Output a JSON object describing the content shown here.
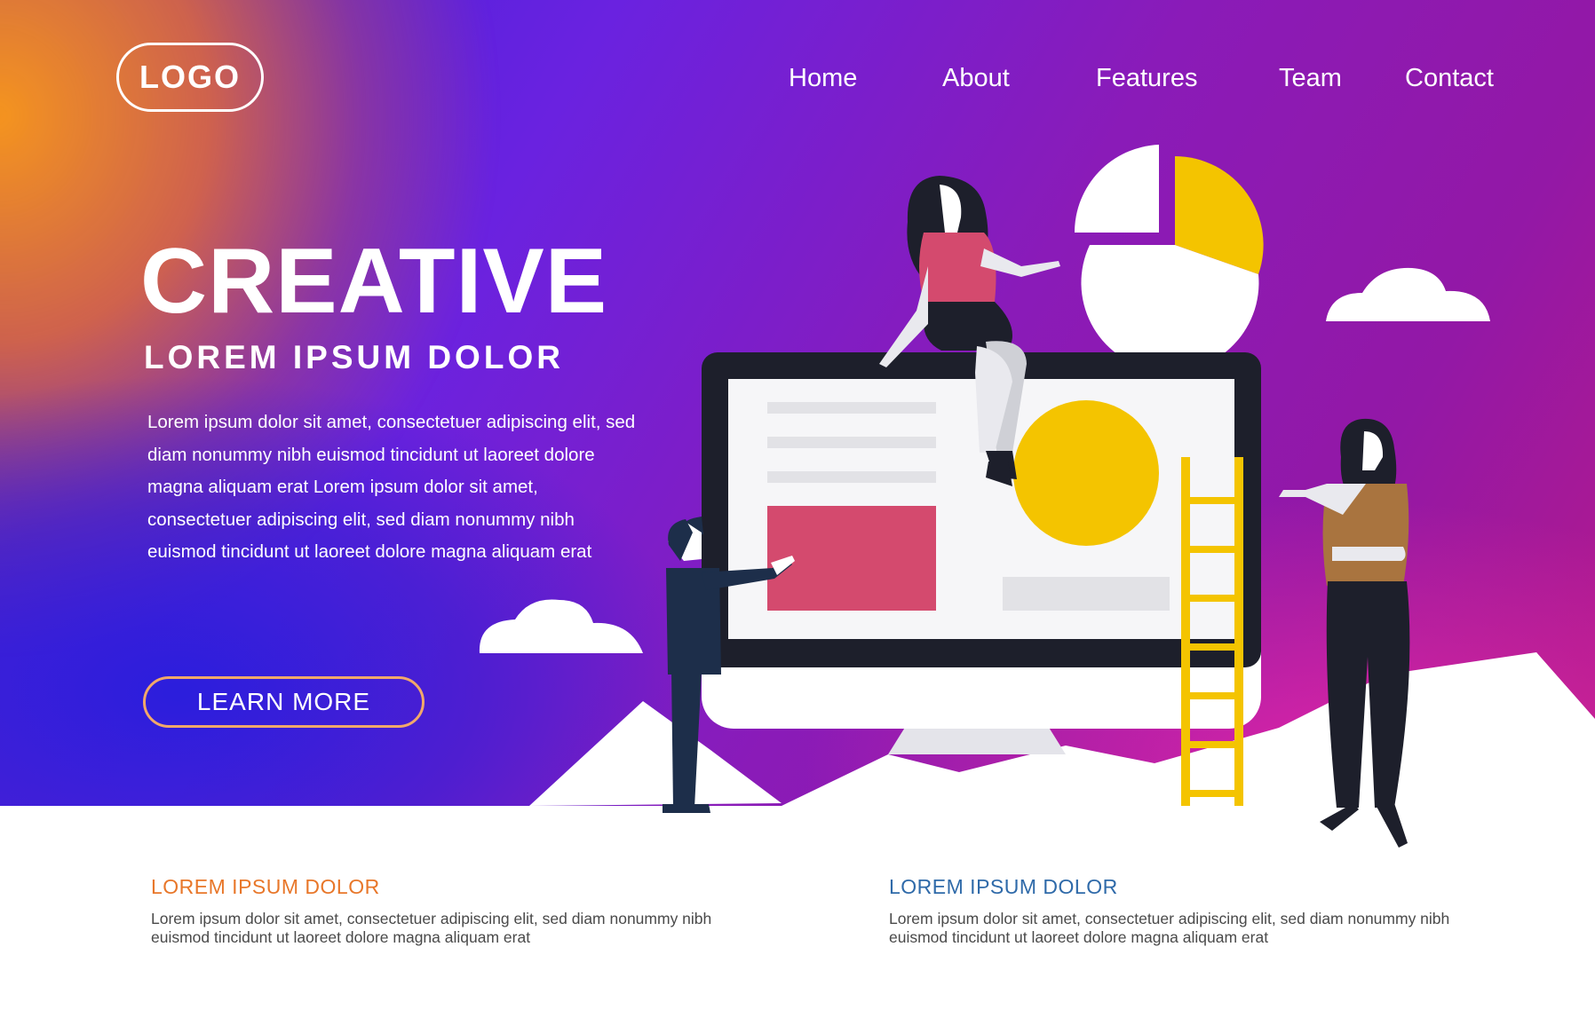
{
  "logo": {
    "text": "LOGO"
  },
  "nav": {
    "items": [
      {
        "label": "Home"
      },
      {
        "label": "About"
      },
      {
        "label": "Features"
      },
      {
        "label": "Team"
      },
      {
        "label": "Contact"
      }
    ]
  },
  "hero": {
    "title": "CREATIVE",
    "subtitle": "LOREM IPSUM DOLOR",
    "body": "Lorem ipsum dolor sit amet, consectetuer adipiscing elit, sed diam nonummy nibh euismod tincidunt ut laoreet dolore magna aliquam erat  Lorem ipsum dolor sit amet, consectetuer adipiscing elit, sed diam nonummy nibh euismod tincidunt ut laoreet dolore magna aliquam erat",
    "cta_label": "LEARN MORE"
  },
  "features": [
    {
      "title": "LOREM IPSUM DOLOR",
      "text": "Lorem ipsum dolor sit amet, consectetuer adipiscing elit, sed diam nonummy nibh euismod tincidunt ut laoreet dolore magna aliquam erat"
    },
    {
      "title": "LOREM IPSUM DOLOR",
      "text": "Lorem ipsum dolor sit amet, consectetuer adipiscing elit, sed diam nonummy nibh euismod tincidunt ut laoreet dolore magna aliquam erat"
    }
  ],
  "colors": {
    "accent_orange": "#e8772a",
    "accent_blue": "#2f6aa9",
    "illustration_yellow": "#f4c400",
    "illustration_pink": "#d44a6e"
  }
}
